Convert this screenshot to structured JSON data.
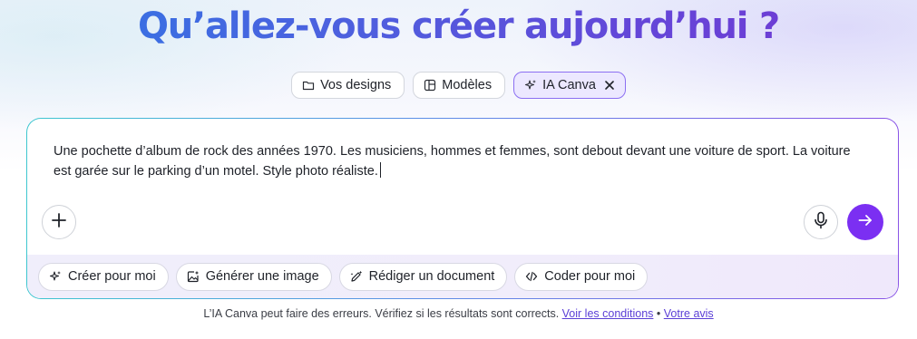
{
  "headline": "Qu’allez-vous créer aujourd’hui ?",
  "modes": [
    {
      "label": "Vos designs",
      "icon": "folder-icon",
      "active": false
    },
    {
      "label": "Modèles",
      "icon": "template-icon",
      "active": false
    },
    {
      "label": "IA Canva",
      "icon": "sparkle-icon",
      "active": true
    }
  ],
  "prompt": {
    "text": "Une pochette d’album de rock des années 1970. Les musiciens, hommes et femmes, sont debout devant une voiture de sport. La voiture est garée sur le parking d’un motel. Style photo réaliste."
  },
  "actions": {
    "add_icon": "plus-icon",
    "mic_icon": "microphone-icon",
    "send_icon": "arrow-right-icon"
  },
  "suggestions": [
    {
      "label": "Créer pour moi",
      "icon": "sparkle-icon"
    },
    {
      "label": "Générer une image",
      "icon": "image-sparkle-icon"
    },
    {
      "label": "Rédiger un document",
      "icon": "pencil-sparkle-icon"
    },
    {
      "label": "Coder pour moi",
      "icon": "code-icon"
    }
  ],
  "disclaimer": {
    "text": "L’IA Canva peut faire des erreurs. Vérifiez si les résultats sont corrects.",
    "link_conditions": "Voir les conditions",
    "separator": "•",
    "link_feedback": "Votre avis"
  },
  "colors": {
    "accent": "#7b2ff2",
    "active_mode_bg": "#ece8ff",
    "link": "#5b3fd6"
  }
}
